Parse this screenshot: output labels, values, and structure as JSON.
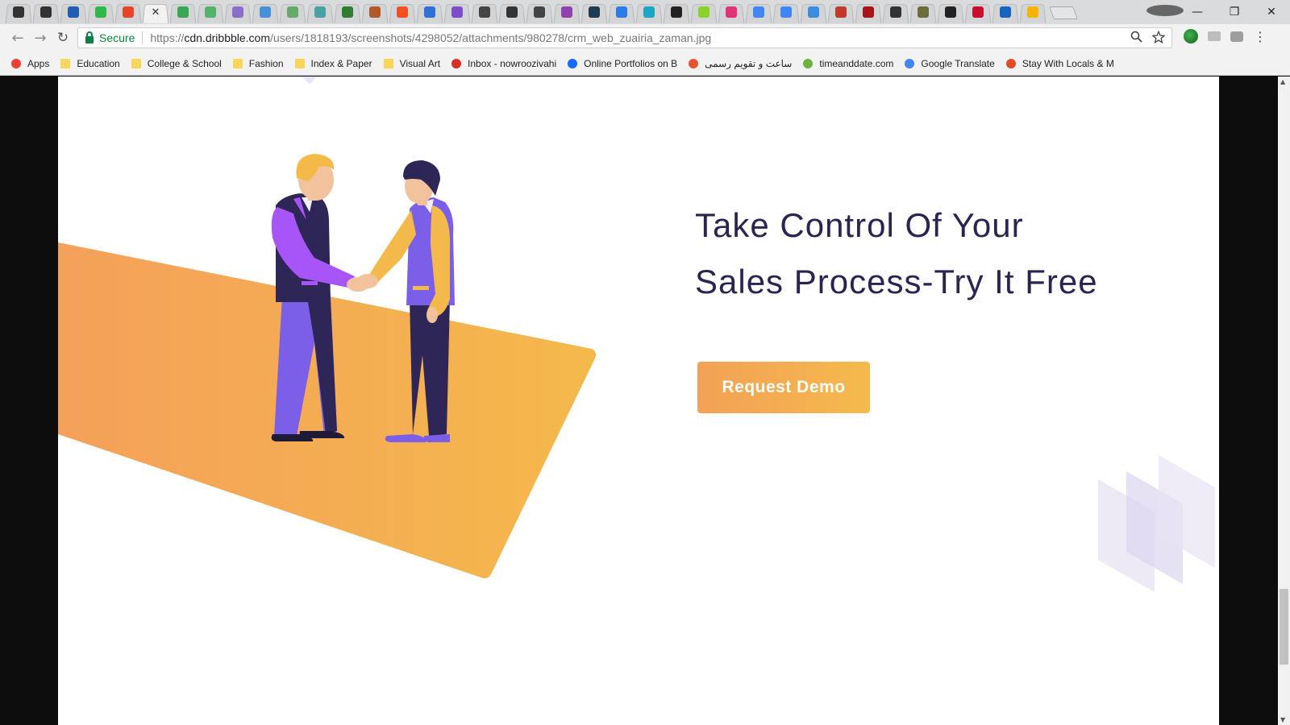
{
  "browser": {
    "tabs": [
      {
        "icon": "layers-icon",
        "color": "#333333"
      },
      {
        "icon": "layers-icon",
        "color": "#333333"
      },
      {
        "icon": "outlook-icon",
        "color": "#1e5fb3"
      },
      {
        "icon": "tag-icon",
        "color": "#2fb84b"
      },
      {
        "icon": "gradient-icon",
        "color": "#e6462e"
      },
      {
        "icon": "close-icon",
        "color": "#333333",
        "active": true
      },
      {
        "icon": "leaf-icon",
        "color": "#3aa756"
      },
      {
        "icon": "globe-icon",
        "color": "#53b36a"
      },
      {
        "icon": "h-letter-icon",
        "color": "#8a6fc9"
      },
      {
        "icon": "cloud-icon",
        "color": "#4a90d9"
      },
      {
        "icon": "chart-icon",
        "color": "#67a86b"
      },
      {
        "icon": "sheet-icon",
        "color": "#4aa1a1"
      },
      {
        "icon": "tree-icon",
        "color": "#2e7d32"
      },
      {
        "icon": "badge-icon",
        "color": "#b05a2b"
      },
      {
        "icon": "windows-icon",
        "color": "#f25022"
      },
      {
        "icon": "c-letter-icon",
        "color": "#2f6fd6"
      },
      {
        "icon": "grid-icon",
        "color": "#7b4fc9"
      },
      {
        "icon": "math-icon",
        "color": "#444444"
      },
      {
        "icon": "square-icon",
        "color": "#333333"
      },
      {
        "icon": "pg-icon",
        "color": "#444444"
      },
      {
        "icon": "pen-icon",
        "color": "#8e44ad"
      },
      {
        "icon": "c-circle-icon",
        "color": "#1f3b4d"
      },
      {
        "icon": "spinner-icon",
        "color": "#2d7be5"
      },
      {
        "icon": "wave-icon",
        "color": "#1ba7c3"
      },
      {
        "icon": "bookmark-icon",
        "color": "#222222"
      },
      {
        "icon": "m-circle-icon",
        "color": "#8bd22e"
      },
      {
        "icon": "camera-icon",
        "color": "#e03474"
      },
      {
        "icon": "google-icon",
        "color": "#4285f4"
      },
      {
        "icon": "google-icon",
        "color": "#4285f4"
      },
      {
        "icon": "dots-icon",
        "color": "#3b8de0"
      },
      {
        "icon": "crest-icon",
        "color": "#c0392b"
      },
      {
        "icon": "w-shield-icon",
        "color": "#a4161a"
      },
      {
        "icon": "shield-icon",
        "color": "#333333"
      },
      {
        "icon": "emblem-icon",
        "color": "#6d6d3a"
      },
      {
        "icon": "bird-icon",
        "color": "#222222"
      },
      {
        "icon": "flag-icon",
        "color": "#c8102e"
      },
      {
        "icon": "w3-icon",
        "color": "#1565c0"
      },
      {
        "icon": "slides-icon",
        "color": "#f4b400"
      }
    ],
    "window_controls": {
      "minimize": "—",
      "restore": "❐",
      "close": "✕"
    },
    "nav": {
      "back": "←",
      "forward": "→",
      "reload": "↻"
    },
    "address": {
      "secure_label": "Secure",
      "scheme": "https://",
      "host": "cdn.dribbble.com",
      "path": "/users/1818193/screenshots/4298052/attachments/980278/crm_web_zuairia_zaman.jpg"
    },
    "bookmarks": [
      {
        "label": "Apps",
        "icon": "apps-grid-icon"
      },
      {
        "label": "Education",
        "icon": "folder-icon"
      },
      {
        "label": "College & School",
        "icon": "folder-icon"
      },
      {
        "label": "Fashion",
        "icon": "folder-icon"
      },
      {
        "label": "Index & Paper",
        "icon": "folder-icon"
      },
      {
        "label": "Visual Art",
        "icon": "folder-icon"
      },
      {
        "label": "Inbox - nowroozivahi",
        "icon": "gmail-icon"
      },
      {
        "label": "Online Portfolios on B",
        "icon": "behance-icon"
      },
      {
        "label": "ساعت و تقویم رسمی",
        "icon": "time-ir-icon"
      },
      {
        "label": "timeanddate.com",
        "icon": "timeanddate-icon"
      },
      {
        "label": "Google Translate",
        "icon": "translate-icon"
      },
      {
        "label": "Stay With Locals & M",
        "icon": "couchsurfing-icon"
      }
    ]
  },
  "hero": {
    "headline_line1": "Take Control Of Your",
    "headline_line2": "Sales Process-Try It Free",
    "cta_label": "Request Demo",
    "colors": {
      "headline": "#2b2451",
      "cta_start": "#f3a156",
      "cta_end": "#f4ba4c",
      "carpet_start": "#f5a05a",
      "carpet_end": "#f4b94b",
      "purple": "#7b5fe8",
      "violet": "#a855f7",
      "navy": "#2d2656"
    }
  }
}
